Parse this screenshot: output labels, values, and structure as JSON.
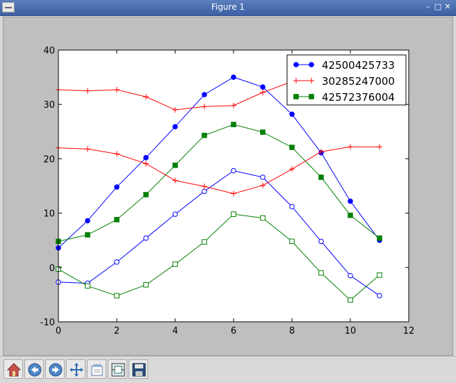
{
  "window": {
    "title": "Figure 1"
  },
  "toolbar": {
    "items": [
      {
        "name": "home-button",
        "icon": "home-icon"
      },
      {
        "name": "back-button",
        "icon": "back-arrow-icon"
      },
      {
        "name": "forward-button",
        "icon": "forward-arrow-icon"
      },
      {
        "name": "pan-button",
        "icon": "pan-arrows-icon"
      },
      {
        "name": "zoom-button",
        "icon": "zoom-rect-icon"
      },
      {
        "name": "configure-subplots-button",
        "icon": "subplots-icon"
      },
      {
        "name": "save-button",
        "icon": "floppy-disk-icon"
      }
    ]
  },
  "chart_data": {
    "type": "line",
    "title": "",
    "xlabel": "",
    "ylabel": "",
    "xlim": [
      0,
      12
    ],
    "ylim": [
      -10,
      40
    ],
    "xticks": [
      0,
      2,
      4,
      6,
      8,
      10,
      12
    ],
    "yticks": [
      -10,
      0,
      10,
      20,
      30,
      40
    ],
    "grid": false,
    "legend_placement": "top-right",
    "x": [
      0,
      1,
      2,
      3,
      4,
      5,
      6,
      7,
      8,
      9,
      10,
      11
    ],
    "series": [
      {
        "name": "42500425733",
        "color": "#0000ff",
        "marker": "circle-filled",
        "legend": true,
        "values": [
          3.6,
          8.6,
          14.8,
          20.2,
          25.9,
          31.8,
          35.0,
          33.2,
          28.2,
          21.1,
          12.2,
          5.0
        ]
      },
      {
        "name": "30285247000",
        "color": "#ff0000",
        "marker": "plus",
        "legend": true,
        "values": [
          32.7,
          32.5,
          32.7,
          31.4,
          29.0,
          29.6,
          29.8,
          32.2,
          34.2,
          35.7,
          35.9,
          35.4
        ]
      },
      {
        "name": "42572376004",
        "color": "#008000",
        "marker": "square-filled",
        "legend": true,
        "values": [
          4.8,
          6.0,
          8.8,
          13.4,
          18.8,
          24.3,
          26.3,
          24.9,
          22.1,
          16.6,
          9.6,
          5.4
        ]
      },
      {
        "name": "",
        "color": "#0000ff",
        "marker": "circle-open",
        "legend": false,
        "values": [
          -2.7,
          -2.9,
          1.0,
          5.4,
          9.8,
          14.0,
          17.8,
          16.6,
          11.2,
          4.8,
          -1.5,
          -5.2
        ]
      },
      {
        "name": "",
        "color": "#ff0000",
        "marker": "plus",
        "legend": false,
        "values": [
          22.0,
          21.8,
          20.9,
          19.1,
          16.0,
          14.9,
          13.6,
          15.1,
          18.1,
          21.3,
          22.2,
          22.2
        ]
      },
      {
        "name": "",
        "color": "#008000",
        "marker": "square-open",
        "legend": false,
        "values": [
          -0.3,
          -3.4,
          -5.2,
          -3.2,
          0.6,
          4.7,
          9.8,
          9.1,
          4.8,
          -1.0,
          -6.0,
          -1.4
        ]
      }
    ]
  }
}
